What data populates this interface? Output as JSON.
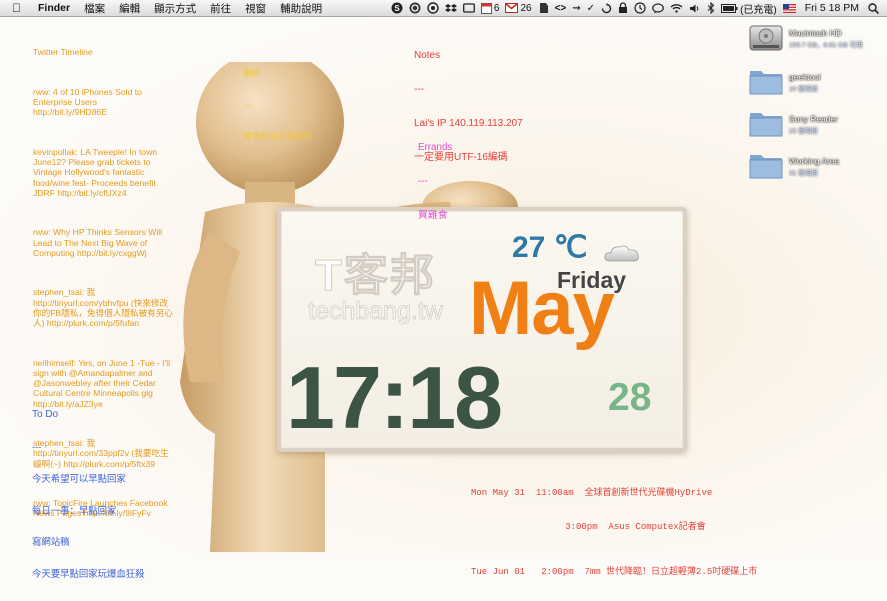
{
  "menubar": {
    "app_name": "Finder",
    "menus": [
      "檔案",
      "編輯",
      "顯示方式",
      "前往",
      "視窗",
      "輔助說明"
    ],
    "calendar_badge": "6",
    "mail_badge": "26",
    "battery_text": "(已充電)",
    "clock": "Fri 5 18 PM"
  },
  "twitter": {
    "title": "Twitter Timeline",
    "items": [
      "rww: 4 of 10 iPhones Sold to Enterprise Users http://bit.ly/9HD86E",
      "kevinpollak: LA Tweeple! In town June12? Please grab tickets to Vintage Hollywood's fantastic food/wine fest- Proceeds benefit JDRF http://bit.ly/cfUXz4",
      "rww: Why HP Thinks Sensors Will Lead to The Next Big Wave of Computing http://bit.ly/cxggWj",
      "stephen_tsai: 我 http://tinyurl.com/ybhvfpu (快來修改你的FB隱私，免得個人隱私被有另心人) http://plurk.com/p/5fufan",
      "neilhimself: Yes, on June 1 -Tue - I'll sign with @Amandapalmer and @Jasonwebley after their Cedar Cultural Centre Minneapolis gig http://bit.ly/aJZ3ye",
      "stephen_tsai: 我 http://tinyurl.com/33ppf2v (我要吃生蠔啊(~) http://plurk.com/p/5ftx39",
      "rww: TopicFire Launches Facebook News Pages http://bit.ly/9lFyFv"
    ]
  },
  "delete_note": {
    "title": "刪除",
    "sep": "---",
    "body": "遠端刪除手機資料"
  },
  "notes": {
    "title": "Notes",
    "sep": "---",
    "line1": "Lai's IP 140.119.113.207",
    "line2": "一定要用UTF-16編碼"
  },
  "errands": {
    "title": "Errands",
    "sep": "---",
    "line1": "買雞食"
  },
  "todo": {
    "title": "To Do",
    "sep": "---",
    "items": [
      "今天希望可以早點回家",
      "每日一事：早點回家",
      "寫網站稿",
      "今天要早點回家玩爆血狂殺"
    ]
  },
  "clock_widget": {
    "temperature": "27 ℃",
    "weekday": "Friday",
    "month": "May",
    "time": "17:18",
    "day": "28"
  },
  "watermark": {
    "cn": "T客邦",
    "en": "techbang.tw"
  },
  "calendar_events": [
    {
      "date": "Mon May 31",
      "time": "11:00am",
      "text": "全球首創新世代光碟機HyDrive"
    },
    {
      "date": "",
      "time": "3:00pm",
      "text": "Asus Computex記者會"
    },
    {
      "date": "Tue Jun 01",
      "time": "2:00pm",
      "text": "7mm 世代降臨！日立超輕薄2.5吋硬碟上市"
    }
  ],
  "desktop_icons": [
    {
      "name": "Macintosh HD",
      "sub": "159.7 GB，8.61 GB 可用",
      "kind": "disk"
    },
    {
      "name": "geektool",
      "sub": "10 個項目",
      "kind": "folder"
    },
    {
      "name": "Sony Reader",
      "sub": "23 個項目",
      "kind": "folder"
    },
    {
      "name": "Working Area",
      "sub": "31 個項目",
      "kind": "folder"
    }
  ],
  "colors": {
    "twitter": "#e49a1e",
    "todo": "#3e63d9",
    "notes": "#e5413a",
    "errands": "#e34ad3",
    "month": "#f07f16",
    "time": "#3b5444",
    "temperature": "#2f79a9",
    "day": "#79b588"
  }
}
